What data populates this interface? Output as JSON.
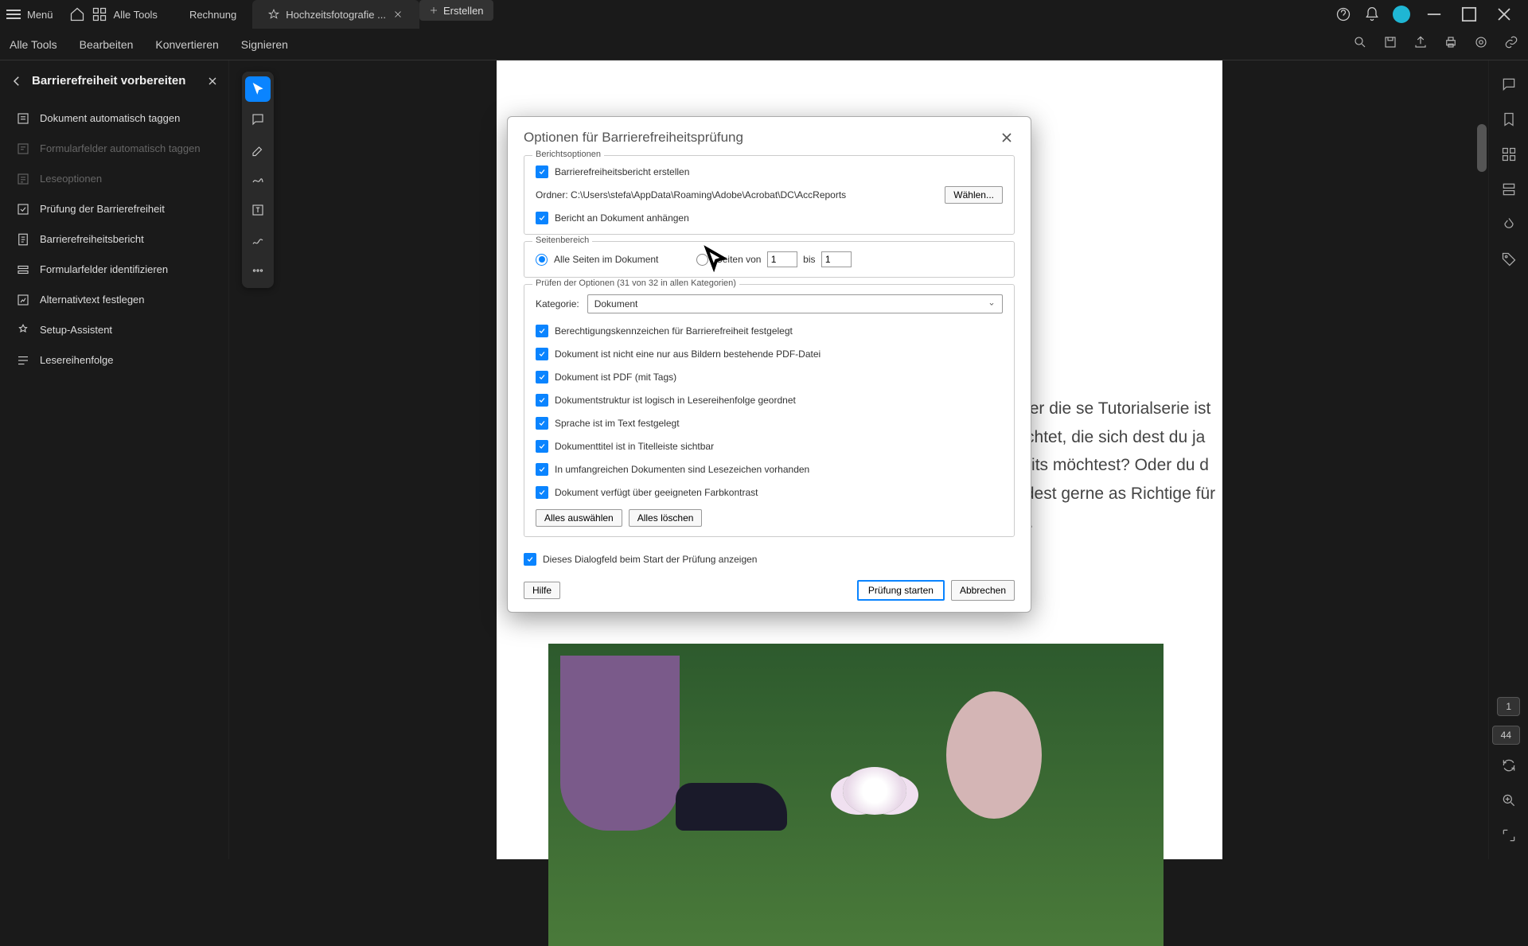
{
  "titlebar": {
    "menu": "Menü",
    "alle_tools": "Alle Tools",
    "tab1": "Rechnung",
    "tab2": "Hochzeitsfotografie ...",
    "create": "Erstellen"
  },
  "toolbar": {
    "items": [
      "Alle Tools",
      "Bearbeiten",
      "Konvertieren",
      "Signieren"
    ]
  },
  "sidebar": {
    "title": "Barrierefreiheit vorbereiten",
    "items": [
      {
        "label": "Dokument automatisch taggen",
        "disabled": false
      },
      {
        "label": "Formularfelder automatisch taggen",
        "disabled": true
      },
      {
        "label": "Leseoptionen",
        "disabled": true
      },
      {
        "label": "Prüfung der Barrierefreiheit",
        "disabled": false
      },
      {
        "label": "Barrierefreiheitsbericht",
        "disabled": false
      },
      {
        "label": "Formularfelder identifizieren",
        "disabled": false
      },
      {
        "label": "Alternativtext festlegen",
        "disabled": false
      },
      {
        "label": "Setup-Assistent",
        "disabled": false
      },
      {
        "label": "Lesereihenfolge",
        "disabled": false
      }
    ]
  },
  "dialog": {
    "title": "Optionen für Barrierefreiheitsprüfung",
    "report_section": "Berichtsoptionen",
    "create_report": "Barrierefreiheitsbericht erstellen",
    "folder_label": "Ordner:",
    "folder_path": "C:\\Users\\stefa\\AppData\\Roaming\\Adobe\\Acrobat\\DC\\AccReports",
    "choose": "Wählen...",
    "attach": "Bericht an Dokument anhängen",
    "page_section": "Seitenbereich",
    "all_pages": "Alle Seiten im Dokument",
    "pages_from": "Seiten von",
    "to": "bis",
    "from_val": "1",
    "to_val": "1",
    "check_section": "Prüfen der Optionen (31 von 32 in allen Kategorien)",
    "category_label": "Kategorie:",
    "category_value": "Dokument",
    "options": [
      "Berechtigungskennzeichen für Barrierefreiheit festgelegt",
      "Dokument ist nicht eine nur aus Bildern bestehende PDF-Datei",
      "Dokument ist PDF (mit Tags)",
      "Dokumentstruktur ist logisch in Lesereihenfolge geordnet",
      "Sprache ist im Text festgelegt",
      "Dokumenttitel ist in Titelleiste sichtbar",
      "In umfangreichen Dokumenten sind Lesezeichen vorhanden",
      "Dokument verfügt über geeigneten Farbkontrast"
    ],
    "select_all": "Alles auswählen",
    "clear_all": "Alles löschen",
    "show_startup": "Dieses Dialogfeld beim Start der Prüfung anzeigen",
    "help": "Hilfe",
    "start": "Prüfung starten",
    "cancel": "Abbrechen"
  },
  "doc": {
    "body_text": "s über die se Tutorialserie ist gerichtet, die sich dest du ja bereits möchtest? Oder du d würdest gerne as Richtige für dich."
  },
  "pages": {
    "current": "1",
    "total": "44"
  }
}
